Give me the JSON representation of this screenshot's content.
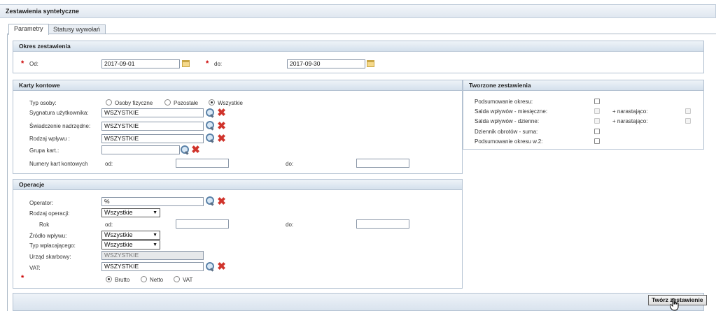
{
  "window": {
    "title": "Zestawienia syntetyczne"
  },
  "tabs": [
    {
      "label": "Parametry",
      "active": true
    },
    {
      "label": "Statusy wywołań",
      "active": false
    }
  ],
  "okres": {
    "title": "Okres zestawienia",
    "from_label": "Od:",
    "from_value": "2017-09-01",
    "to_label": "do:",
    "to_value": "2017-09-30"
  },
  "karty": {
    "title": "Karty kontowe",
    "typ_osoby_label": "Typ osoby:",
    "typ_osoby_options": [
      "Osoby fizyczne",
      "Pozostałe",
      "Wszystkie"
    ],
    "typ_osoby_selected": "Wszystkie",
    "sygnatura_label": "Sygnatura użytkownika:",
    "sygnatura_value": "WSZYSTKIE",
    "swiadczenie_label": "Świadczenie nadrzędne:",
    "swiadczenie_value": "WSZYSTKIE",
    "rodzaj_label": "Rodzaj wpływu :",
    "rodzaj_value": "WSZYSTKIE",
    "grupa_label": "Grupa kart.:",
    "grupa_value": "",
    "numery_label": "Numery kart kontowych",
    "od_label": "od:",
    "do_label": "do:"
  },
  "tworzone": {
    "title": "Tworzone zestawienia",
    "items": [
      {
        "label": "Podsumowanie okresu:",
        "enabled": true
      },
      {
        "label": "Salda wpływów - miesięczne:",
        "enabled": false,
        "extra": "+ narastająco:"
      },
      {
        "label": "Salda wpływów - dzienne:",
        "enabled": false,
        "extra": "+ narastająco:"
      },
      {
        "label": "Dziennik obrotów - suma:",
        "enabled": true
      },
      {
        "label": "Podsumowanie okresu w.2:",
        "enabled": true
      }
    ]
  },
  "operacje": {
    "title": "Operacje",
    "operator_label": "Operator:",
    "operator_value": "%",
    "rodzaj_label": "Rodzaj operacji:",
    "rodzaj_value": "Wszystkie",
    "rok_label": "Rok",
    "od_label": "od:",
    "do_label": "do:",
    "zrodlo_label": "Źródło wpływu:",
    "zrodlo_value": "Wszystkie",
    "typ_label": "Typ wpłacającego:",
    "typ_value": "Wszystkie",
    "urzad_label": "Urząd skarbowy:",
    "urzad_value": "WSZYSTKIE",
    "vat_label": "VAT:",
    "vat_value": "WSZYSTKIE",
    "vat_mode_options": [
      "Brutto",
      "Netto",
      "VAT"
    ],
    "vat_mode_selected": "Brutto"
  },
  "required_mark": "*",
  "footer": {
    "button_label": "Twórz zestawienie"
  }
}
